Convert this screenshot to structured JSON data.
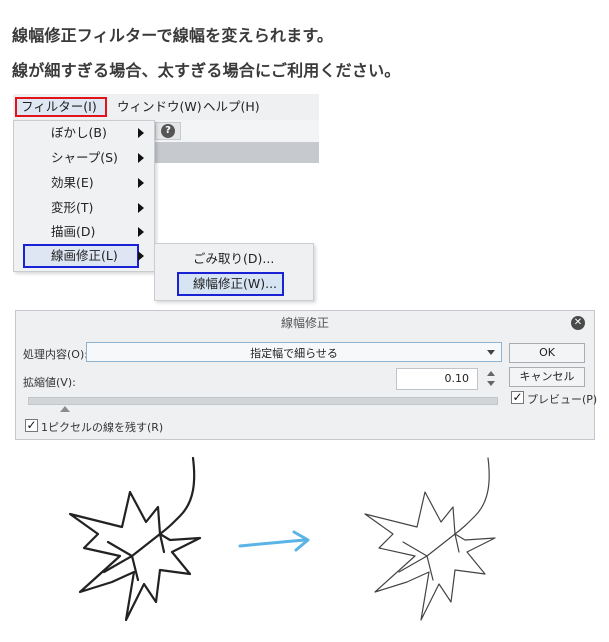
{
  "headings": {
    "line1": "線幅修正フィルターで線幅を変えられます。",
    "line2": "線が細すぎる場合、太すぎる場合にご利用ください。"
  },
  "menubar": {
    "filter": "フィルター(I)",
    "window": "ウィンドウ(W)",
    "help": "ヘルプ(H)"
  },
  "filter_menu": {
    "items": [
      {
        "label": "ぼかし(B)"
      },
      {
        "label": "シャープ(S)"
      },
      {
        "label": "効果(E)"
      },
      {
        "label": "変形(T)"
      },
      {
        "label": "描画(D)"
      },
      {
        "label": "線画修正(L)"
      }
    ]
  },
  "submenu": {
    "items": [
      {
        "label": "ごみ取り(D)..."
      },
      {
        "label": "線幅修正(W)..."
      }
    ]
  },
  "dialog": {
    "title": "線幅修正",
    "process_label": "処理内容(O):",
    "process_value": "指定幅で細らせる",
    "scale_label": "拡縮値(V):",
    "scale_value": "0.10",
    "ok": "OK",
    "cancel": "キャンセル",
    "preview": "プレビュー(P)",
    "preview_checked": true,
    "keep_pixel": "1ピクセルの線を残す(R)",
    "keep_pixel_checked": true
  },
  "colors": {
    "highlight_red": "#e0141a",
    "highlight_blue": "#1a22d6",
    "arrow": "#5ab4e6"
  }
}
